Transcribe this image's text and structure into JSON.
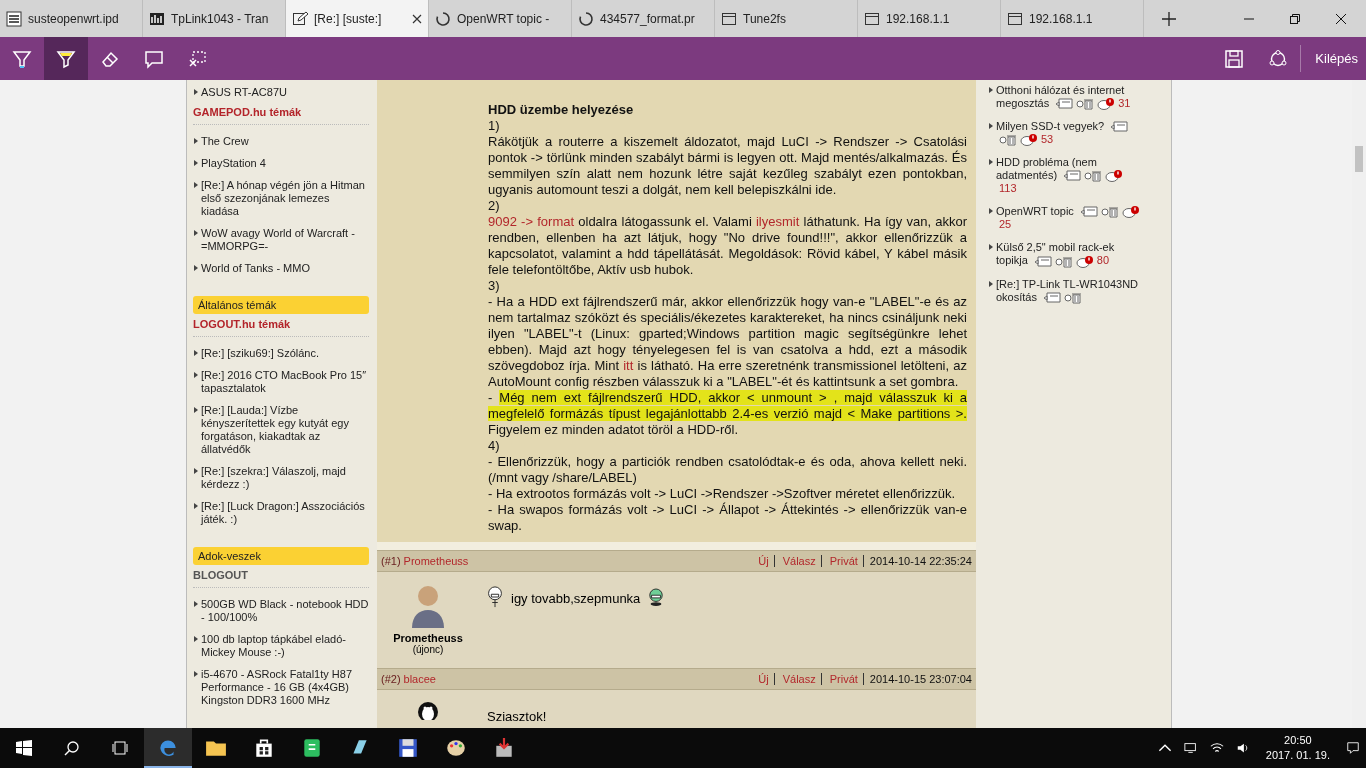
{
  "tabs": [
    {
      "kind": "logo",
      "title": "susteopenwrt.ipd",
      "selected": false
    },
    {
      "kind": "chart",
      "title": "TpLink1043 - Tran",
      "selected": false
    },
    {
      "kind": "edit",
      "title": "[Re:] [suste:]",
      "selected": true
    },
    {
      "kind": "ring",
      "title": "OpenWRT topic -",
      "selected": false
    },
    {
      "kind": "ring",
      "title": "434577_format.pr",
      "selected": false
    },
    {
      "kind": "page",
      "title": "Tune2fs",
      "selected": false
    },
    {
      "kind": "page",
      "title": "192.168.1.1",
      "selected": false
    },
    {
      "kind": "page",
      "title": "192.168.1.1",
      "selected": false
    }
  ],
  "toolbar": {
    "tools": [
      {
        "kind": "pen",
        "selected": false
      },
      {
        "kind": "highlighter",
        "selected": true
      },
      {
        "kind": "eraser",
        "selected": false
      },
      {
        "kind": "note",
        "selected": false
      },
      {
        "kind": "clip",
        "selected": false
      }
    ],
    "exit_label": "Kilépés"
  },
  "left_sidebar": [
    {
      "kind": "item",
      "text": "ASUS RT-AC87U"
    },
    {
      "kind": "heading",
      "text": "GAMEPOD.hu témák"
    },
    {
      "kind": "item",
      "text": "The Crew"
    },
    {
      "kind": "item",
      "text": "PlayStation 4"
    },
    {
      "kind": "item",
      "text": "[Re:] A hónap végén jön a Hitman első szezonjának lemezes kiadása"
    },
    {
      "kind": "item",
      "text": "WoW avagy World of Warcraft -=MMORPG=-"
    },
    {
      "kind": "item",
      "text": "World of Tanks - MMO"
    },
    {
      "kind": "tab",
      "text": "Általános témák"
    },
    {
      "kind": "heading",
      "text": "LOGOUT.hu témák"
    },
    {
      "kind": "item",
      "text": "[Re:] [sziku69:] Szólánc."
    },
    {
      "kind": "item",
      "text": "[Re:] 2016 CTO MacBook Pro 15″ tapasztalatok"
    },
    {
      "kind": "item",
      "text": "[Re:] [Lauda:] Vízbe kényszerítettek egy kutyát egy forgatáson, kiakadtak az állatvédők"
    },
    {
      "kind": "item",
      "text": "[Re:] [szekra:] Válaszolj, majd kérdezz :)"
    },
    {
      "kind": "item",
      "text": "[Re:] [Luck Dragon:] Asszociációs játék. :)"
    },
    {
      "kind": "tab",
      "text": "Adok-veszek"
    },
    {
      "kind": "subheading",
      "text": "BLOGOUT"
    },
    {
      "kind": "item",
      "text": "500GB WD Black - notebook HDD - 100/100%"
    },
    {
      "kind": "item",
      "text": "100 db laptop tápkábel eladó- Mickey Mouse :-)"
    },
    {
      "kind": "item",
      "text": "i5-4670 - ASRock Fatal1ty H87 Performance - 16 GB (4x4GB) Kingston DDR3 1600 MHz"
    }
  ],
  "article": [
    {
      "kind": "heading",
      "segments": [
        {
          "kind": "text",
          "text": "HDD üzembe helyezése"
        }
      ]
    },
    {
      "kind": "text",
      "segments": [
        {
          "kind": "text",
          "text": "1)"
        }
      ]
    },
    {
      "kind": "text",
      "segments": [
        {
          "kind": "text",
          "text": "Rákötjük a routerre a kiszemelt áldozatot, majd LuCI -> Rendszer -> Csatolási pontok -> törlünk minden szabályt bármi is legyen ott. Majd mentés/alkalmazás. És semmilyen szín alatt nem hozunk létre saját kezűleg szabályt ezen pontokban, ugyanis automount teszi a dolgát, nem kell belepiszkálni ide."
        }
      ]
    },
    {
      "kind": "text",
      "segments": [
        {
          "kind": "text",
          "text": "2)"
        }
      ]
    },
    {
      "kind": "text",
      "segments": [
        {
          "kind": "link",
          "text": "9092 -> format"
        },
        {
          "kind": "text",
          "text": " oldalra látogassunk el. Valami "
        },
        {
          "kind": "link",
          "text": "ilyesmit"
        },
        {
          "kind": "text",
          "text": " láthatunk. Ha így van, akkor rendben, ellenben ha azt látjuk, hogy \"No drive found!!!\", akkor ellenőrizzük a kapcsolatot, valamint a hdd tápellátását. Megoldások: Rövid kábel, Y kábel másik fele telefontöltőbe, Aktív usb hubok."
        }
      ]
    },
    {
      "kind": "text",
      "segments": [
        {
          "kind": "text",
          "text": "3)"
        }
      ]
    },
    {
      "kind": "text",
      "segments": [
        {
          "kind": "text",
          "text": "- Ha a HDD ext fájlrendszerű már, akkor ellenőrizzük hogy van-e \"LABEL\"-e és az nem tartalmaz szóközt és speciális/ékezetes karaktereket, ha nincs csináljunk neki ilyen \"LABEL\"-t (Linux: gparted;Windows partition magic segítségünkre lehet ebben). Majd azt hogy tényelegesen fel is van csatolva a hdd, ezt a második szövegdoboz írja. Mint "
        },
        {
          "kind": "link",
          "text": "itt"
        },
        {
          "kind": "text",
          "text": " is látható. Ha erre szeretnénk transmissionel letölteni, az AutoMount config részben válasszuk ki a \"LABEL\"-ét és kattintsunk a set gombra."
        }
      ]
    },
    {
      "kind": "text",
      "segments": [
        {
          "kind": "text",
          "text": "- "
        },
        {
          "kind": "highlight",
          "text": "Még nem ext fájlrendszerű HDD, akkor < unmount > , majd válasszuk ki a megfelelő formázás típust legajánlottabb 2.4-es verzió majd < Make partitions >."
        },
        {
          "kind": "text",
          "text": " Figyelem ez minden adatot töröl a HDD-ről."
        }
      ]
    },
    {
      "kind": "text",
      "segments": [
        {
          "kind": "text",
          "text": "4)"
        }
      ]
    },
    {
      "kind": "text",
      "segments": [
        {
          "kind": "text",
          "text": "- Ellenőrizzük, hogy a particiók rendben csatolódtak-e és oda, ahova kellett neki. (/mnt vagy /share/LABEL)"
        }
      ]
    },
    {
      "kind": "text",
      "segments": [
        {
          "kind": "text",
          "text": "- Ha extrootos formázás volt -> LuCI ->Rendszer ->Szoftver méretet ellenőrizzük."
        }
      ]
    },
    {
      "kind": "text",
      "segments": [
        {
          "kind": "text",
          "text": "- Ha swapos formázás volt -> LuCI -> Állapot -> Áttekintés -> ellenőrizzük van-e swap."
        }
      ]
    }
  ],
  "posts": [
    {
      "number": "(#1)",
      "author": "Prometheuss",
      "actions": [
        "Új",
        "Válasz",
        "Privát"
      ],
      "date": "2014-10-14 22:35:24",
      "kind": "person",
      "name": "Prometheuss",
      "rank": "(újonc)",
      "smileys": true,
      "text": "igy tovabb,szepmunka"
    },
    {
      "number": "(#2)",
      "author": "blacee",
      "actions": [
        "Új",
        "Válasz",
        "Privát"
      ],
      "date": "2014-10-15 23:07:04",
      "kind": "penguin",
      "smileys": false,
      "text": "Sziasztok!"
    }
  ],
  "right_sidebar": [
    {
      "text": "Otthoni hálózat és internet megosztás",
      "unread": true,
      "count": "31"
    },
    {
      "text": "Milyen SSD-t vegyek?",
      "unread": true,
      "count": "53"
    },
    {
      "text": "HDD probléma (nem adatmentés)",
      "unread": true,
      "count": "113"
    },
    {
      "text": "OpenWRT topic",
      "unread": true,
      "count": "25"
    },
    {
      "text": "Külső 2,5\" mobil rack-ek topikja",
      "unread": true,
      "count": "80"
    },
    {
      "text": "[Re:] TP-Link TL-WR1043ND okosítás",
      "unread": false
    }
  ],
  "taskbar": {
    "apps": [
      {
        "kind": "edge",
        "active": true
      },
      {
        "kind": "folder",
        "active": false
      },
      {
        "kind": "store",
        "active": false
      },
      {
        "kind": "note",
        "active": false
      },
      {
        "kind": "blue",
        "active": false
      },
      {
        "kind": "disk",
        "active": false
      },
      {
        "kind": "paint",
        "active": false
      },
      {
        "kind": "install",
        "active": false
      }
    ],
    "time": "20:50",
    "date": "2017. 01. 19."
  }
}
